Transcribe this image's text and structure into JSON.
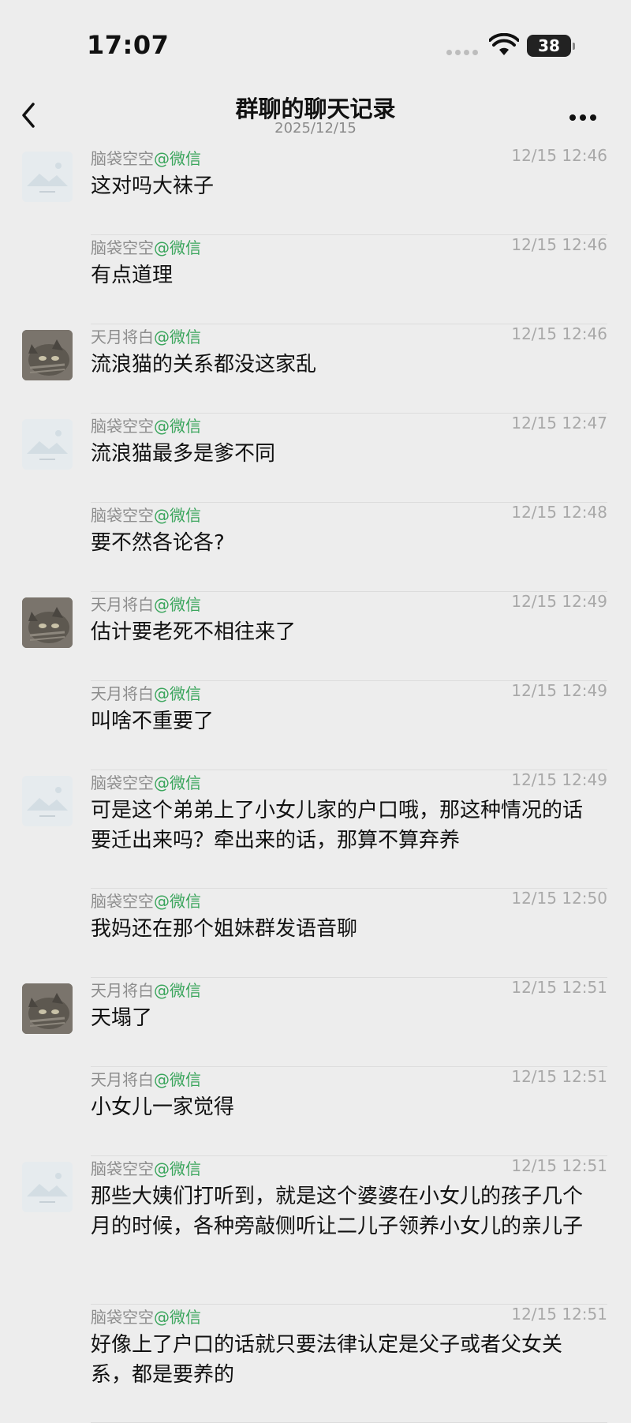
{
  "status": {
    "time": "17:07",
    "battery": "38"
  },
  "header": {
    "title": "群聊的聊天记录",
    "date": "2025/12/15"
  },
  "messages": [
    {
      "sender": "脑袋空空",
      "source": "@微信",
      "time": "12/15 12:46",
      "text": "这对吗大袜子",
      "avatar": "placeholder"
    },
    {
      "sender": "脑袋空空",
      "source": "@微信",
      "time": "12/15 12:46",
      "text": "有点道理",
      "avatar": ""
    },
    {
      "sender": "天月将白",
      "source": "@微信",
      "time": "12/15 12:46",
      "text": "流浪猫的关系都没这家乱",
      "avatar": "cat"
    },
    {
      "sender": "脑袋空空",
      "source": "@微信",
      "time": "12/15 12:47",
      "text": "流浪猫最多是爹不同",
      "avatar": "placeholder"
    },
    {
      "sender": "脑袋空空",
      "source": "@微信",
      "time": "12/15 12:48",
      "text": "要不然各论各?",
      "avatar": ""
    },
    {
      "sender": "天月将白",
      "source": "@微信",
      "time": "12/15 12:49",
      "text": "估计要老死不相往来了",
      "avatar": "cat"
    },
    {
      "sender": "天月将白",
      "source": "@微信",
      "time": "12/15 12:49",
      "text": "叫啥不重要了",
      "avatar": ""
    },
    {
      "sender": "脑袋空空",
      "source": "@微信",
      "time": "12/15 12:49",
      "text": "可是这个弟弟上了小女儿家的户口哦，那这种情况的话要迁出来吗？牵出来的话，那算不算弃养",
      "avatar": "placeholder"
    },
    {
      "sender": "脑袋空空",
      "source": "@微信",
      "time": "12/15 12:50",
      "text": "我妈还在那个姐妹群发语音聊",
      "avatar": ""
    },
    {
      "sender": "天月将白",
      "source": "@微信",
      "time": "12/15 12:51",
      "text": "天塌了",
      "avatar": "cat"
    },
    {
      "sender": "天月将白",
      "source": "@微信",
      "time": "12/15 12:51",
      "text": "小女儿一家觉得",
      "avatar": ""
    },
    {
      "sender": "脑袋空空",
      "source": "@微信",
      "time": "12/15 12:51",
      "text": "那些大姨们打听到，就是这个婆婆在小女儿的孩子几个月的时候，各种旁敲侧听让二儿子领养小女儿的亲儿子",
      "avatar": "placeholder"
    },
    {
      "sender": "脑袋空空",
      "source": "@微信",
      "time": "12/15 12:51",
      "text": "好像上了户口的话就只要法律认定是父子或者父女关系，都是要养的",
      "avatar": ""
    }
  ]
}
